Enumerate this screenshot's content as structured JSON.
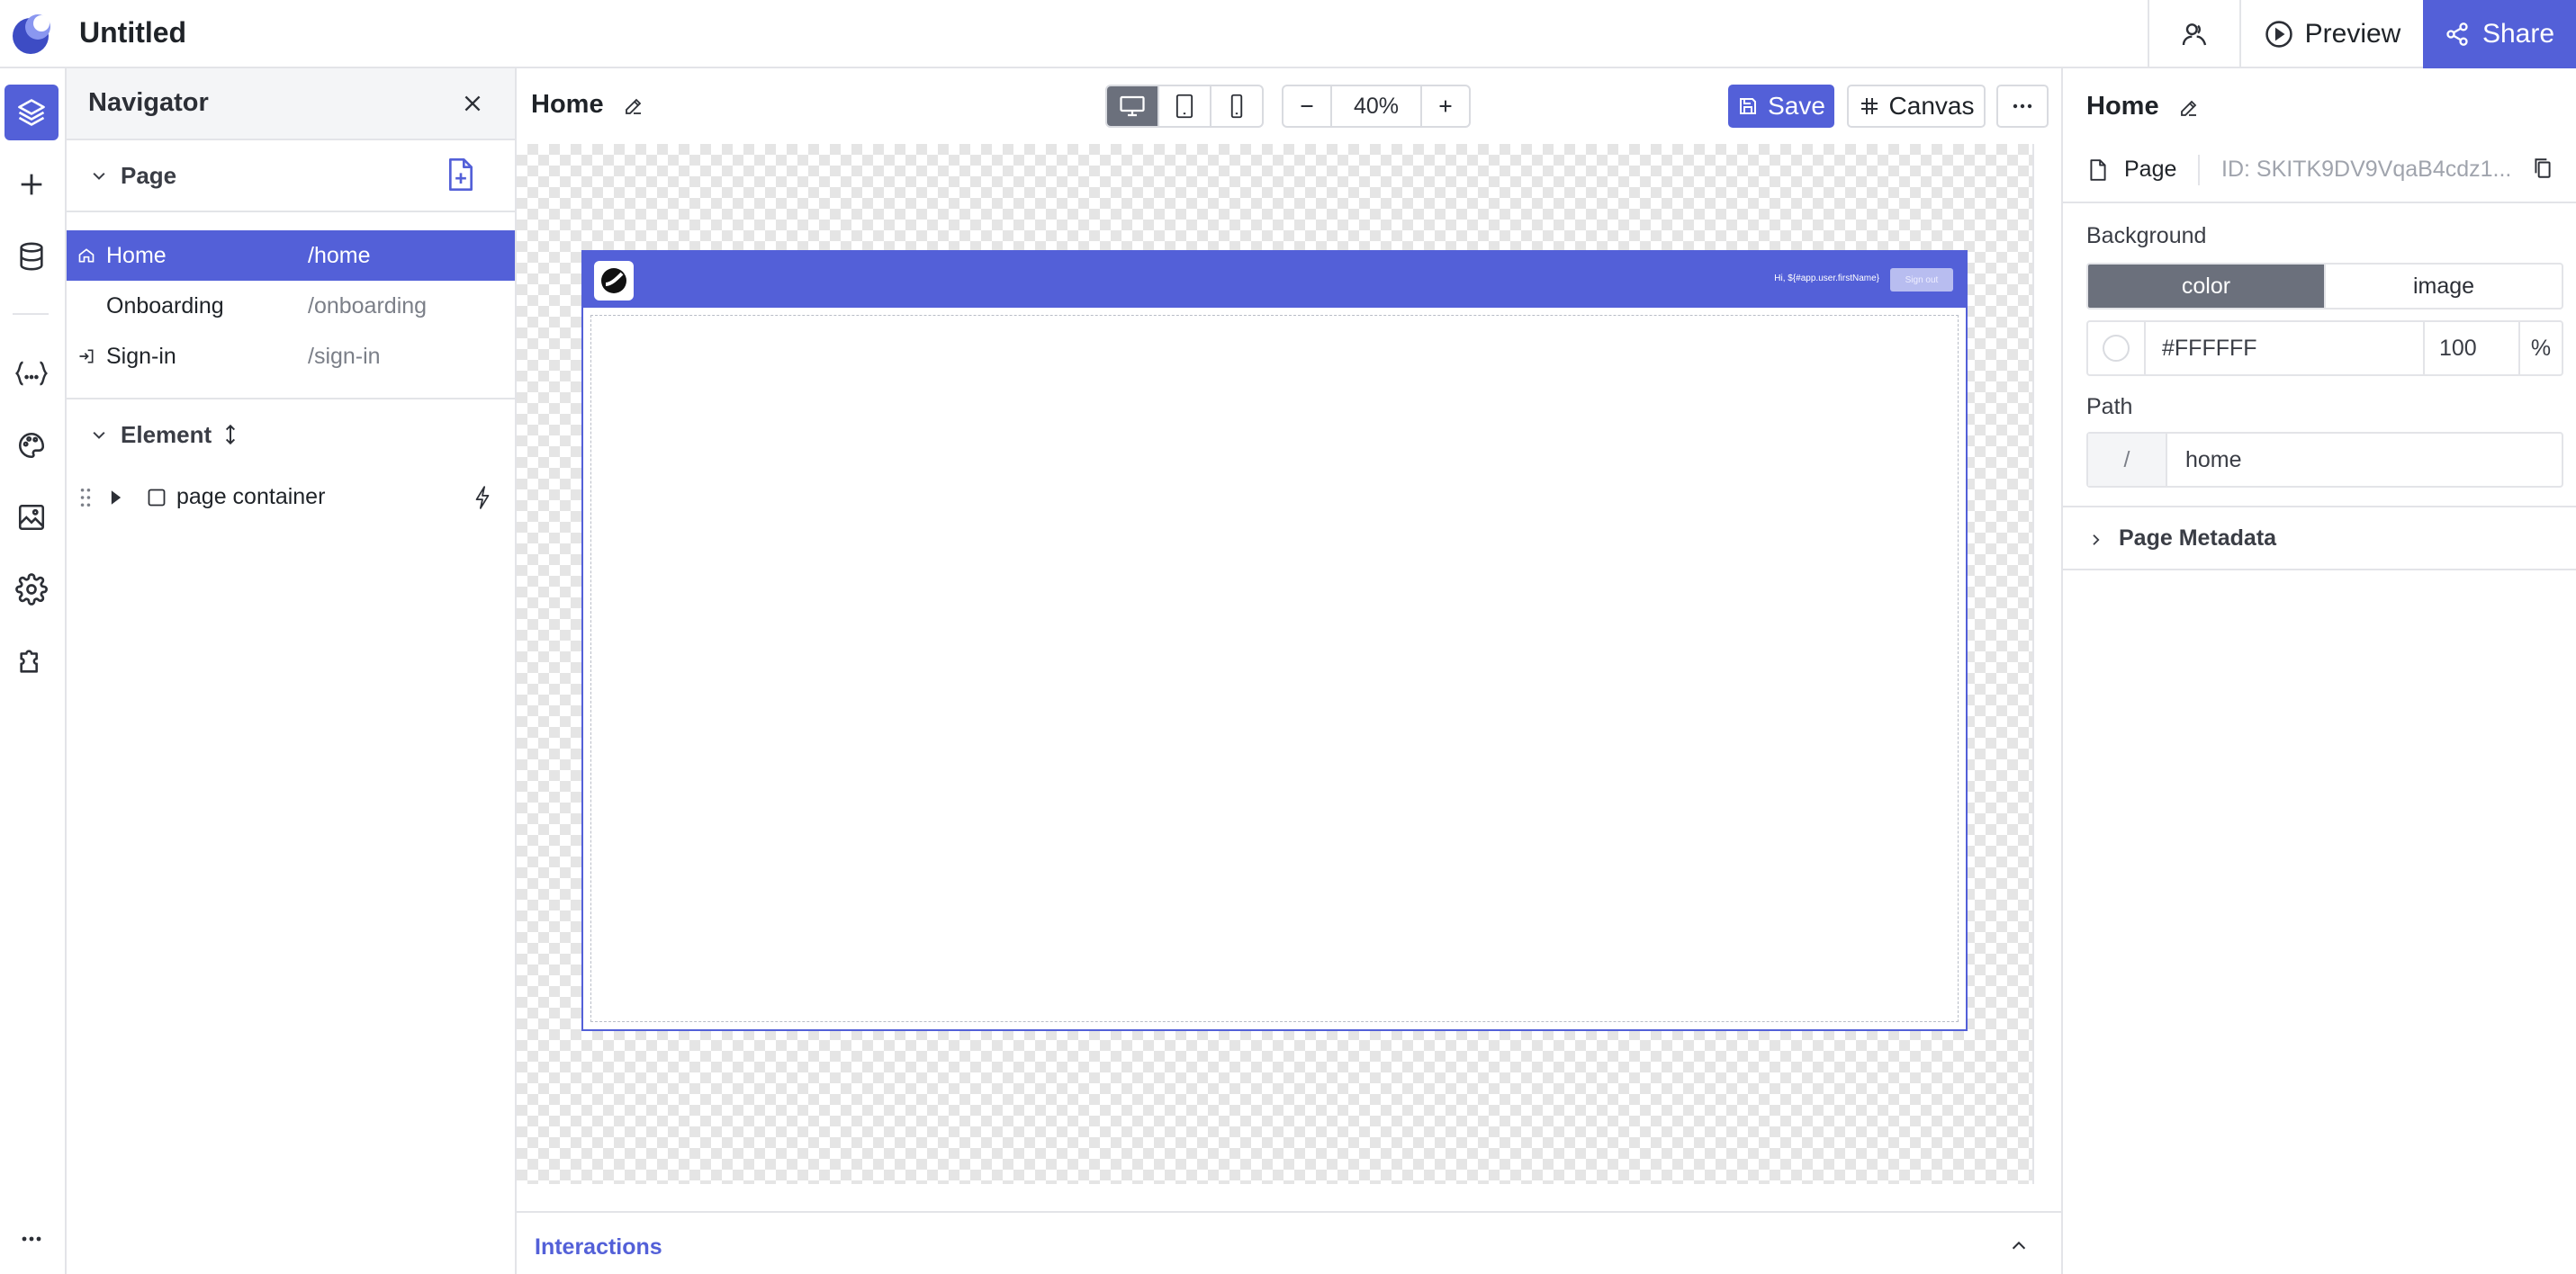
{
  "app": {
    "title": "Untitled"
  },
  "topbar": {
    "preview_label": "Preview",
    "share_label": "Share"
  },
  "navigator": {
    "title": "Navigator",
    "page_section_label": "Page",
    "pages": [
      {
        "name": "Home",
        "path": "/home",
        "active": true,
        "icon": "home-icon"
      },
      {
        "name": "Onboarding",
        "path": "/onboarding",
        "active": false,
        "icon": ""
      },
      {
        "name": "Sign-in",
        "path": "/sign-in",
        "active": false,
        "icon": "sign-in-icon"
      }
    ],
    "element_section_label": "Element",
    "elements": [
      {
        "label": "page container"
      }
    ]
  },
  "editor": {
    "page_name": "Home",
    "zoom": "40%",
    "save_label": "Save",
    "canvas_label": "Canvas",
    "preview_frame": {
      "greeting": "Hi, ${#app.user.firstName}",
      "sign_out_label": "Sign out"
    },
    "interactions_label": "Interactions"
  },
  "inspector": {
    "title": "Home",
    "type_label": "Page",
    "id_text": "ID: SKITK9DV9VqaB4cdz1...",
    "background_label": "Background",
    "bg_options": [
      "color",
      "image"
    ],
    "bg_selected": "color",
    "color_value": "#FFFFFF",
    "opacity_value": "100",
    "opacity_unit": "%",
    "path_label": "Path",
    "path_prefix": "/",
    "path_value": "home",
    "metadata_label": "Page Metadata"
  },
  "colors": {
    "accent": "#5360d8",
    "active_segment": "#6b707c"
  }
}
